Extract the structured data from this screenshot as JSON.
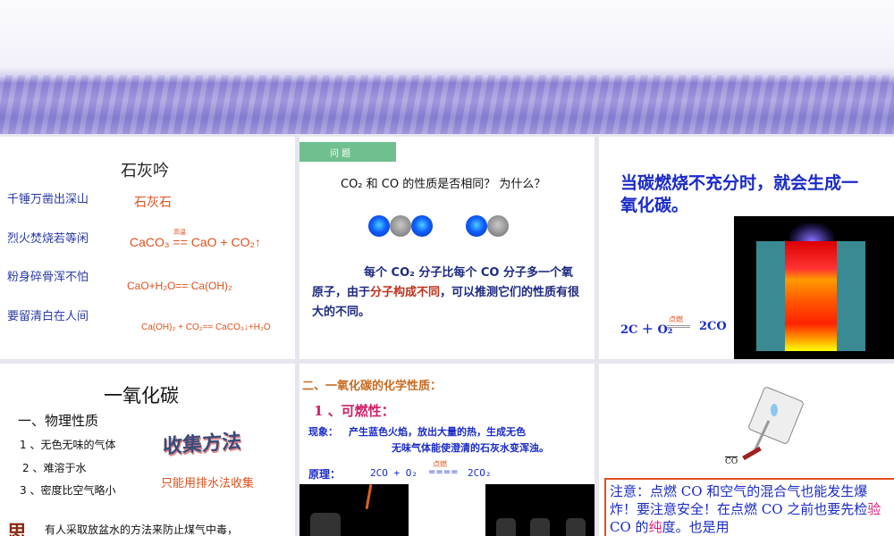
{
  "slide1": {
    "title": "石灰吟",
    "poem": [
      "千锤万凿出深山",
      "烈火焚烧若等闲",
      "粉身碎骨浑不怕",
      "要留清白在人间"
    ],
    "limestone": "石灰石",
    "condition": "高温",
    "eq1": "CaCO₃ == CaO + CO₂↑",
    "eq2": "CaO+H₂O== Ca(OH)₂",
    "eq3": "Ca(OH)₂ + CO₂== CaCO₃↓+H₂O"
  },
  "slide2": {
    "tag": "问 题",
    "question": "CO₂ 和 CO 的性质是否相同？ 为什么？",
    "answer_a": "每个 CO₂ 分子比每个  CO 分子多一个氧原子，由于",
    "answer_hl": "分子构成不同",
    "answer_b": "，可以推测它们的性质有很大的不同。"
  },
  "slide3": {
    "text": "当碳燃烧不充分时，就会生成一氧化碳。",
    "condition": "点燃",
    "eq_left": "2C ＋ O₂",
    "eq_right": "2CO"
  },
  "slide4": {
    "title": "一氧化碳",
    "section": "一、物理性质",
    "items": [
      "1 、无色无味的气体",
      "2 、难溶于水",
      "3 、密度比空气略小"
    ],
    "art": "收集方法",
    "collect": "只能用排水法收集",
    "think_icon": "思",
    "note": "有人采取放盆水的方法来防止煤气中毒，"
  },
  "slide5": {
    "heading": "二、一氧化碳的化学性质：",
    "sub": "1 、可燃性：",
    "phen_label": "现象：",
    "phen1": "产生蓝色火焰，放出大量的热，生成无色",
    "phen2": "无味气体能使澄清的石灰水变浑浊。",
    "principle": "原理：",
    "eq_left": "2CO + O₂",
    "condition": "点燃",
    "eq_sign": "====",
    "eq_right": "2CO₂"
  },
  "slide6": {
    "gas_label": "CO",
    "note_a": "注意：点燃 CO 和空气的混合气也能发生爆炸！要注意安全！在点燃 CO 之前也要先检",
    "note_hl1": "验",
    "note_b": " CO 的",
    "note_hl2": "纯",
    "note_c": "度。也是用"
  }
}
